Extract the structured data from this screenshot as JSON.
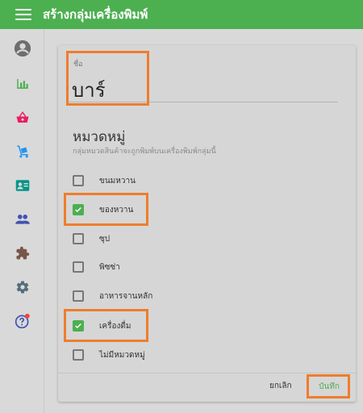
{
  "appbar": {
    "title": "สร้างกลุ่มเครื่องพิมพ์",
    "menu_icon": "menu-icon"
  },
  "sidebar": {
    "items": [
      {
        "icon": "account-circle-icon",
        "color": "#6d6d6d"
      },
      {
        "icon": "bar-chart-icon",
        "color": "#4caf50"
      },
      {
        "icon": "shopping-basket-icon",
        "color": "#e91e63"
      },
      {
        "icon": "dolly-icon",
        "color": "#2196f3"
      },
      {
        "icon": "contact-card-icon",
        "color": "#009688"
      },
      {
        "icon": "people-icon",
        "color": "#3f51b5"
      },
      {
        "icon": "puzzle-icon",
        "color": "#795548"
      },
      {
        "icon": "gear-icon",
        "color": "#546e7a"
      },
      {
        "icon": "help-icon",
        "color": "#3f51b5",
        "badge_color": "#f44336"
      }
    ]
  },
  "form": {
    "name_label": "ชื่อ",
    "name_value": "บาร์",
    "section_title": "หมวดหมู่",
    "section_desc": "กลุ่มหมวดสินค้าจะถูกพิมพ์บนเครื่องพิมพ์กลุ่มนี้",
    "categories": [
      {
        "label": "ขนมหวาน",
        "checked": false
      },
      {
        "label": "ของหวาน",
        "checked": true
      },
      {
        "label": "ซุป",
        "checked": false
      },
      {
        "label": "พิซซ่า",
        "checked": false
      },
      {
        "label": "อาหารจานหลัก",
        "checked": false
      },
      {
        "label": "เครื่องดื่ม",
        "checked": true
      },
      {
        "label": "ไม่มีหมวดหมู่",
        "checked": false
      }
    ],
    "cancel_label": "ยกเลิก",
    "save_label": "บันทึก"
  },
  "colors": {
    "accent": "#4caf50",
    "highlight": "#ee7d2d"
  }
}
